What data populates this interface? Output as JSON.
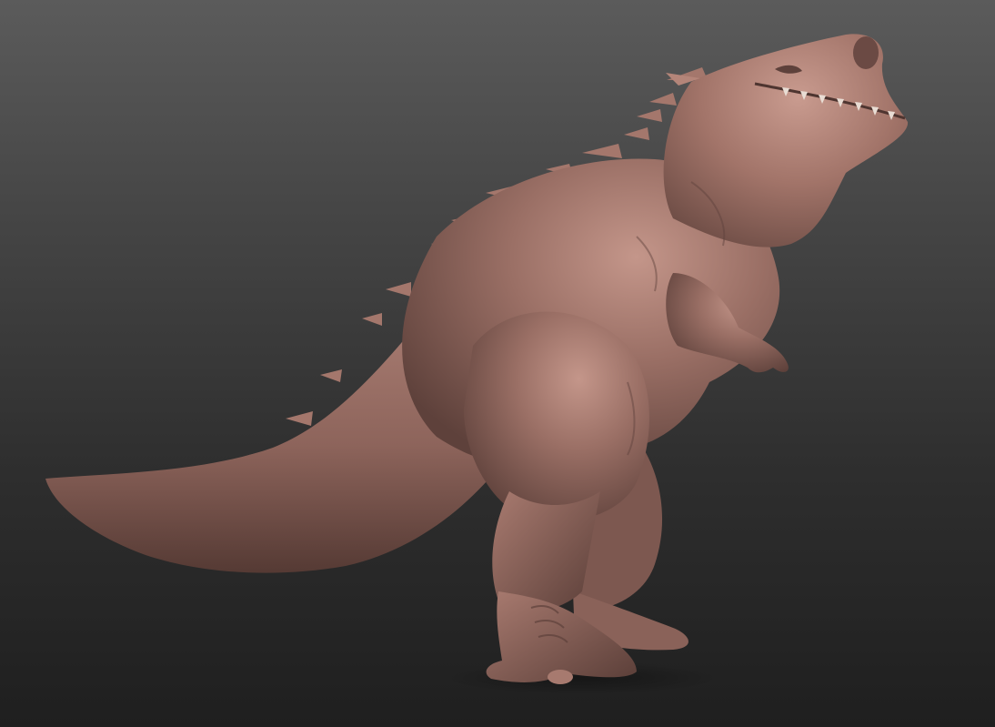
{
  "scene": {
    "subject_icon": "dinosaur-sculpt",
    "colors": {
      "background_top": "#5b5b5b",
      "background_bottom": "#1f1f1f",
      "clay": "#9a6f65",
      "clay_highlight": "#c4968a",
      "clay_shadow": "#5e413b",
      "teeth": "#e9ddd4"
    }
  }
}
